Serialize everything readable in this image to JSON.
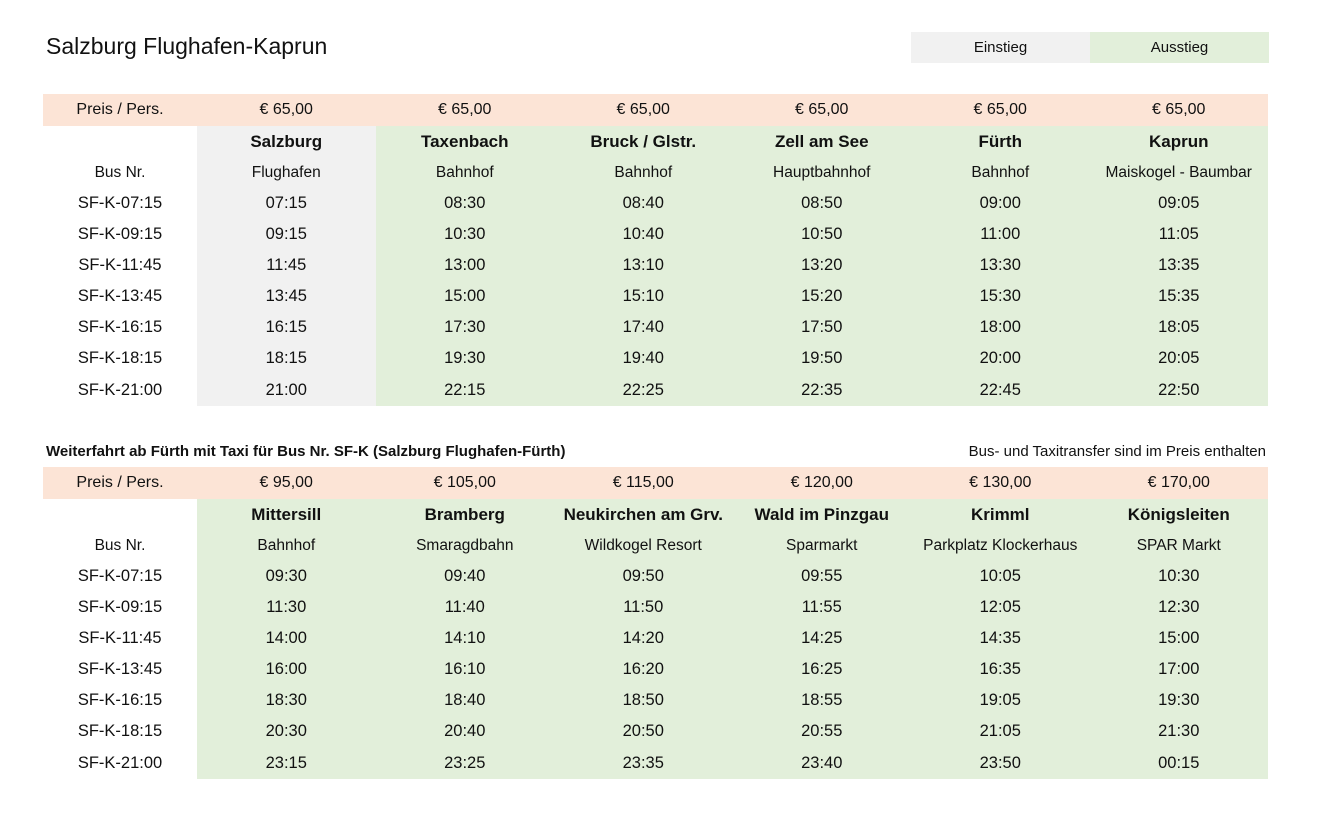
{
  "title": "Salzburg Flughafen-Kaprun",
  "legend": {
    "einstieg": "Einstieg",
    "ausstieg": "Ausstieg"
  },
  "colors": {
    "price_row": "#fce4d6",
    "einstieg": "#f1f1f1",
    "ausstieg": "#e2efda"
  },
  "table1": {
    "price_label": "Preis / Pers.",
    "prices": [
      "€ 65,00",
      "€ 65,00",
      "€ 65,00",
      "€ 65,00",
      "€ 65,00",
      "€ 65,00"
    ],
    "stops": [
      "Salzburg",
      "Taxenbach",
      "Bruck / Glstr.",
      "Zell am See",
      "Fürth",
      "Kaprun"
    ],
    "bus_label": "Bus Nr.",
    "substops": [
      "Flughafen",
      "Bahnhof",
      "Bahnhof",
      "Hauptbahnhof",
      "Bahnhof",
      "Maiskogel - Baumbar"
    ],
    "rows": [
      {
        "bus": "SF-K-07:15",
        "times": [
          "07:15",
          "08:30",
          "08:40",
          "08:50",
          "09:00",
          "09:05"
        ]
      },
      {
        "bus": "SF-K-09:15",
        "times": [
          "09:15",
          "10:30",
          "10:40",
          "10:50",
          "11:00",
          "11:05"
        ]
      },
      {
        "bus": "SF-K-11:45",
        "times": [
          "11:45",
          "13:00",
          "13:10",
          "13:20",
          "13:30",
          "13:35"
        ]
      },
      {
        "bus": "SF-K-13:45",
        "times": [
          "13:45",
          "15:00",
          "15:10",
          "15:20",
          "15:30",
          "15:35"
        ]
      },
      {
        "bus": "SF-K-16:15",
        "times": [
          "16:15",
          "17:30",
          "17:40",
          "17:50",
          "18:00",
          "18:05"
        ]
      },
      {
        "bus": "SF-K-18:15",
        "times": [
          "18:15",
          "19:30",
          "19:40",
          "19:50",
          "20:00",
          "20:05"
        ]
      },
      {
        "bus": "SF-K-21:00",
        "times": [
          "21:00",
          "22:15",
          "22:25",
          "22:35",
          "22:45",
          "22:50"
        ]
      }
    ]
  },
  "notes": {
    "left": "Weiterfahrt ab Fürth mit Taxi für Bus Nr. SF-K (Salzburg Flughafen-Fürth)",
    "right": "Bus- und Taxitransfer sind im Preis enthalten"
  },
  "table2": {
    "price_label": "Preis / Pers.",
    "prices": [
      "€ 95,00",
      "€ 105,00",
      "€ 115,00",
      "€ 120,00",
      "€ 130,00",
      "€ 170,00"
    ],
    "stops": [
      "Mittersill",
      "Bramberg",
      "Neukirchen am Grv.",
      "Wald im Pinzgau",
      "Krimml",
      "Königsleiten"
    ],
    "bus_label": "Bus Nr.",
    "substops": [
      "Bahnhof",
      "Smaragdbahn",
      "Wildkogel Resort",
      "Sparmarkt",
      "Parkplatz Klockerhaus",
      "SPAR Markt"
    ],
    "rows": [
      {
        "bus": "SF-K-07:15",
        "times": [
          "09:30",
          "09:40",
          "09:50",
          "09:55",
          "10:05",
          "10:30"
        ]
      },
      {
        "bus": "SF-K-09:15",
        "times": [
          "11:30",
          "11:40",
          "11:50",
          "11:55",
          "12:05",
          "12:30"
        ]
      },
      {
        "bus": "SF-K-11:45",
        "times": [
          "14:00",
          "14:10",
          "14:20",
          "14:25",
          "14:35",
          "15:00"
        ]
      },
      {
        "bus": "SF-K-13:45",
        "times": [
          "16:00",
          "16:10",
          "16:20",
          "16:25",
          "16:35",
          "17:00"
        ]
      },
      {
        "bus": "SF-K-16:15",
        "times": [
          "18:30",
          "18:40",
          "18:50",
          "18:55",
          "19:05",
          "19:30"
        ]
      },
      {
        "bus": "SF-K-18:15",
        "times": [
          "20:30",
          "20:40",
          "20:50",
          "20:55",
          "21:05",
          "21:30"
        ]
      },
      {
        "bus": "SF-K-21:00",
        "times": [
          "23:15",
          "23:25",
          "23:35",
          "23:40",
          "23:50",
          "00:15"
        ]
      }
    ]
  }
}
